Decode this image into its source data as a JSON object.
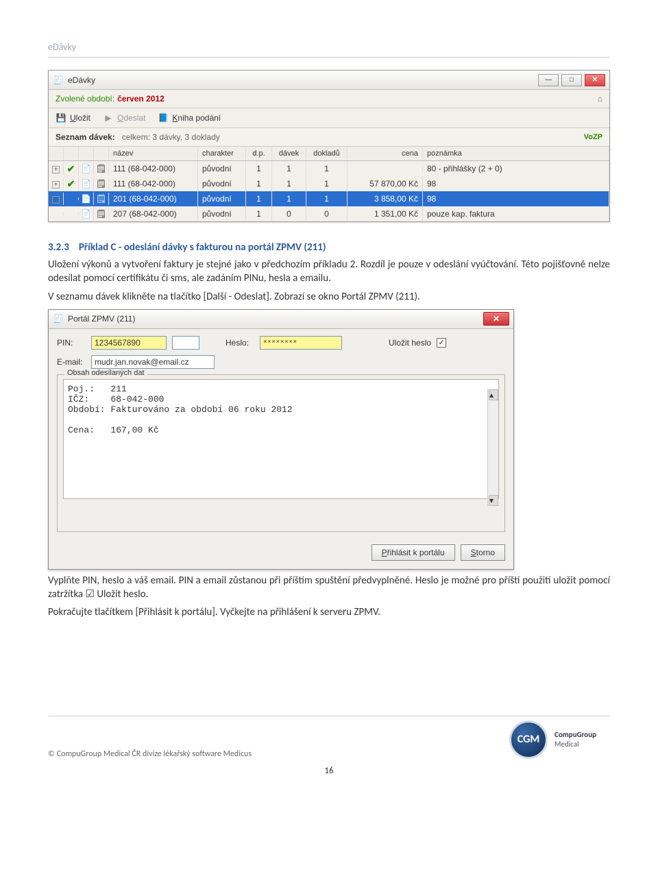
{
  "header": {
    "title": "eDávky"
  },
  "win": {
    "title": "eDávky",
    "period_label": "Zvolené období:",
    "period_value": "červen 2012",
    "toolbar": {
      "save": "Uložit",
      "send": "Odeslat",
      "kniha": "Kniha podání"
    },
    "summary": {
      "label": "Seznam dávek:",
      "value": "celkem: 3 dávky, 3 doklady",
      "badge": "VoZP"
    },
    "columns": {
      "nazev": "název",
      "charakter": "charakter",
      "dp": "d.p.",
      "davek": "dávek",
      "dokladu": "dokladů",
      "cena": "cena",
      "poznamka": "poznámka"
    },
    "rows": [
      {
        "expand": true,
        "check": true,
        "nazev": "111 (68-042-000)",
        "charakter": "původní",
        "dp": "1",
        "davek": "1",
        "dokladu": "1",
        "cena": "",
        "poznamka": "80 - přihlášky (2 + 0)",
        "sel": false
      },
      {
        "expand": true,
        "check": true,
        "nazev": "111 (68-042-000)",
        "charakter": "původní",
        "dp": "1",
        "davek": "1",
        "dokladu": "1",
        "cena": "57 870,00 Kč",
        "poznamka": "98",
        "sel": false
      },
      {
        "expand": true,
        "check": false,
        "nazev": "201 (68-042-000)",
        "charakter": "původní",
        "dp": "1",
        "davek": "1",
        "dokladu": "1",
        "cena": "3 858,00 Kč",
        "poznamka": "98",
        "sel": true
      },
      {
        "expand": false,
        "check": false,
        "nazev": "207 (68-042-000)",
        "charakter": "původní",
        "dp": "1",
        "davek": "0",
        "dokladu": "0",
        "cena": "1 351,00 Kč",
        "poznamka": "pouze kap. faktura",
        "sel": false
      }
    ]
  },
  "section": {
    "num": "3.2.3",
    "title": "Příklad C - odeslání dávky s fakturou na portál ZPMV (211)",
    "para1": "Uložení výkonů a vytvoření faktury je stejné jako v předchozím příkladu 2. Rozdíl je pouze v odeslání vyúčtování. Této pojišťovně nelze odesílat pomocí certifikátu či sms, ale zadáním PINu, hesla a emailu.",
    "para2": "V seznamu dávek klikněte na tlačítko [Další - Odeslat]. Zobrazí se okno Portál ZPMV (211).",
    "para3a": "Vyplňte PIN, heslo a váš email. PIN a email zůstanou při příštím spuštění předvyplněné. Heslo je možné pro příští použití uložit pomocí zatržítka ",
    "para3check": "☑",
    "para3b": " Uložit heslo.",
    "para4": "Pokračujte tlačítkem [Přihlásit k portálu]. Vyčkejte na přihlášení k serveru ZPMV."
  },
  "dlg": {
    "title": "Portál ZPMV (211)",
    "pin_label": "PIN:",
    "pin_value": "1234567890",
    "heslo_label": "Heslo:",
    "heslo_value": "××××××××",
    "ulozit_label": "Uložit heslo",
    "email_label": "E-mail:",
    "email_value": "mudr.jan.novak@email.cz",
    "fieldset_legend": "Obsah odesílaných dat",
    "mono": "Poj.:   211\nIČZ:    68-042-000\nObdobí: Fakturováno za období 06 roku 2012\n\nCena:   167,00 Kč",
    "btn_login": "Přihlásit k portálu",
    "btn_cancel": "Storno"
  },
  "footer": {
    "copyright": "© CompuGroup Medical ČR divize lékařský software Medicus",
    "logo_abbr": "CGM",
    "logo_top": "CompuGroup",
    "logo_bot": "Medical",
    "page": "16"
  }
}
